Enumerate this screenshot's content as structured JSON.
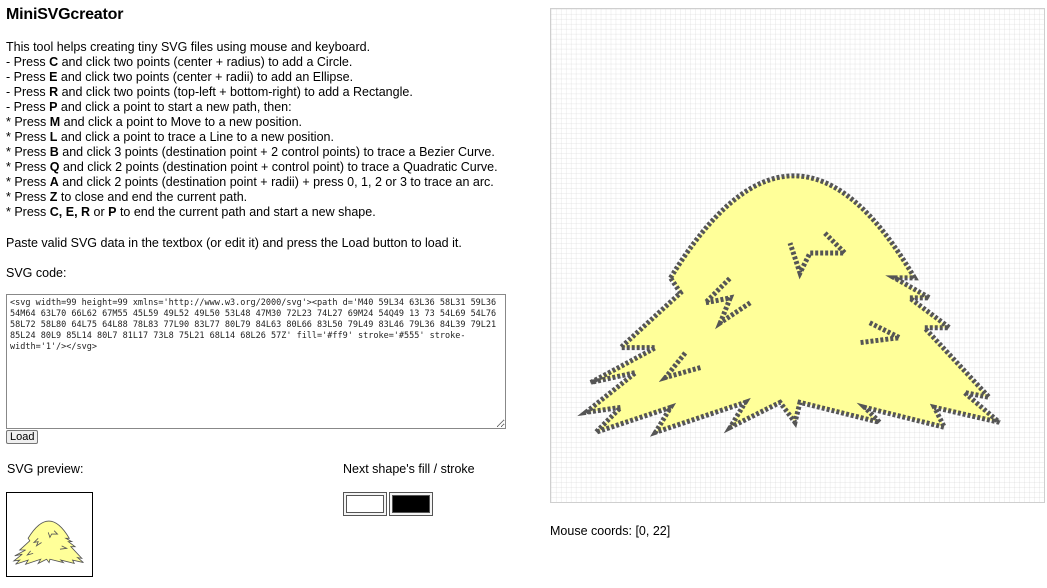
{
  "app": {
    "title": "MiniSVGcreator"
  },
  "intro": {
    "line1": "This tool helps creating tiny SVG files using mouse and keyboard.",
    "items": [
      {
        "pre": "- Press ",
        "key": "C",
        "post": " and click two points (center + radius) to add a Circle."
      },
      {
        "pre": "- Press ",
        "key": "E",
        "post": " and click two points (center + radii) to add an Ellipse."
      },
      {
        "pre": "- Press ",
        "key": "R",
        "post": " and click two points (top-left + bottom-right) to add a Rectangle."
      },
      {
        "pre": "- Press ",
        "key": "P",
        "post": " and click a point to start a new path, then:"
      },
      {
        "pre": " * Press ",
        "key": "M",
        "post": " and click a point to Move to a new position."
      },
      {
        "pre": " * Press ",
        "key": "L",
        "post": " and click a point to trace a Line to a new position."
      },
      {
        "pre": " * Press ",
        "key": "B",
        "post": " and click 3 points (destination point + 2 control points) to trace a Bezier Curve."
      },
      {
        "pre": " * Press ",
        "key": "Q",
        "post": " and click 2 points (destination point + control point) to trace a Quadratic Curve."
      },
      {
        "pre": " * Press ",
        "key": "A",
        "post": " and click 2 points (destination point + radii) + press 0, 1, 2 or 3 to trace an arc."
      },
      {
        "pre": " * Press ",
        "key": "Z",
        "post": " to close and end the current path."
      },
      {
        "pre": " * Press ",
        "key": "C, E, R",
        "post": " or ",
        "key2": "P",
        "post2": " to end the current path and start a new shape."
      }
    ]
  },
  "paste_note": "Paste valid SVG data in the textbox (or edit it) and press the Load button to load it.",
  "code_label": "SVG code:",
  "svg_code": "<svg width=99 height=99 xmlns='http://www.w3.org/2000/svg'><path d='M40 59L34 63L36 58L31 59L36 54M64 63L70 66L62 67M55 45L59 49L52 49L50 53L48 47M30 72L23 74L27 69M24 54Q49 13 73 54L69 54L76 58L72 58L80 64L75 64L88 78L83 77L90 83L77 80L79 84L63 80L66 83L50 79L49 83L46 79L36 84L39 79L21 85L24 80L9 85L14 80L7 81L17 73L8 75L21 68L14 68L26 57Z' fill='#ff9' stroke='#555' stroke-width='1'/></svg>",
  "load_label": "Load",
  "preview_label": "SVG preview:",
  "fill_label": "Next shape's fill / stroke",
  "colors": {
    "next_fill": "#ffffff",
    "next_stroke": "#000000",
    "shape_fill": "#ffff99",
    "shape_stroke": "#555555",
    "grid_line": "#cfcfcf"
  },
  "coords_text": "Mouse coords: [0, 22]"
}
